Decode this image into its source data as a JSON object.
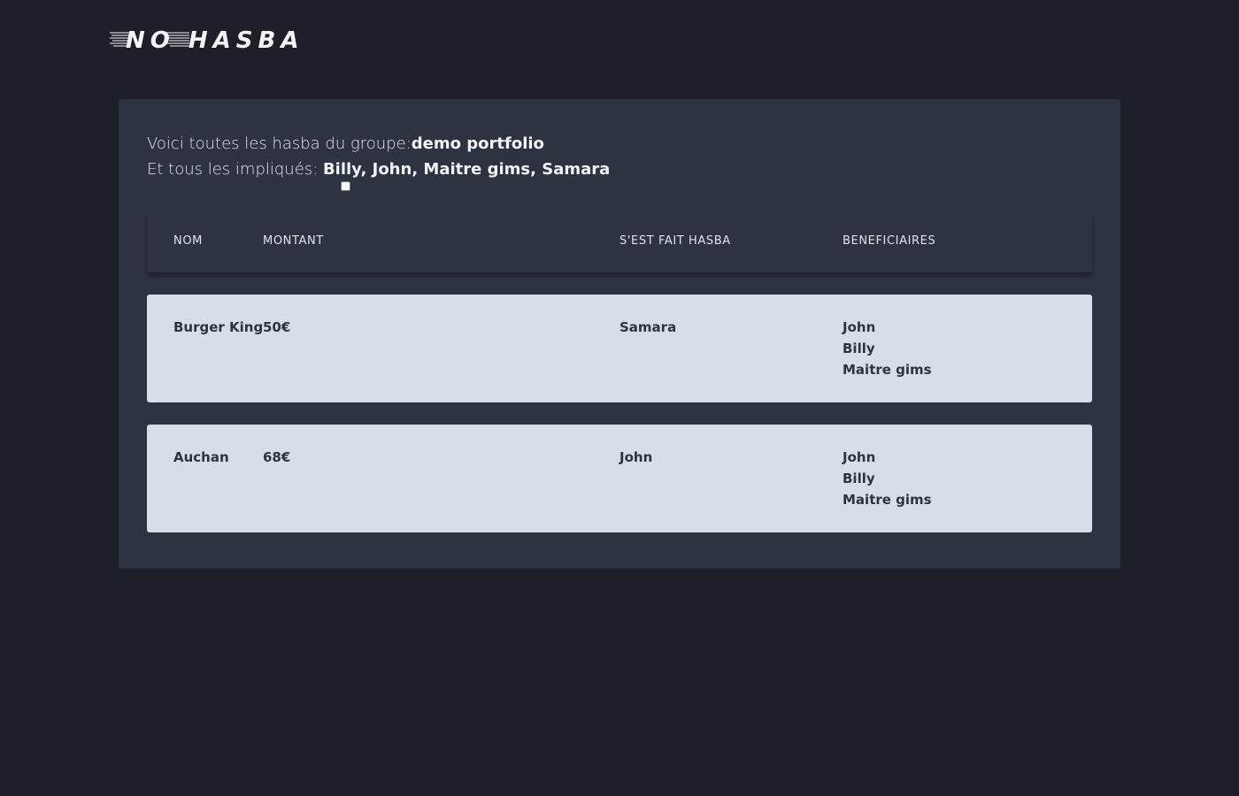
{
  "brand": {
    "logo_text": "NO HASBA"
  },
  "intro": {
    "group_prefix": "Voici toutes les hasba du groupe:",
    "group_name": "demo portfolio",
    "members_prefix": "Et tous les impliqués: ",
    "members": "Billy, John, Maitre gims, Samara"
  },
  "table": {
    "headers": {
      "nom": "NOM",
      "montant": "MONTANT",
      "payer": "S'EST FAIT HASBA",
      "beneficiaires": "BENEFICIAIRES"
    },
    "rows": [
      {
        "nom": "Burger King",
        "montant": "50€",
        "payer": "Samara",
        "beneficiaires": [
          "John",
          "Billy",
          "Maitre gims"
        ]
      },
      {
        "nom": "Auchan",
        "montant": "68€",
        "payer": "John",
        "beneficiaires": [
          "John",
          "Billy",
          "Maitre gims"
        ]
      }
    ]
  },
  "colors": {
    "page_bg": "#1d2028",
    "panel_bg": "#2e3342",
    "row_bg": "#d8dee9",
    "row_text": "#2e3342"
  }
}
